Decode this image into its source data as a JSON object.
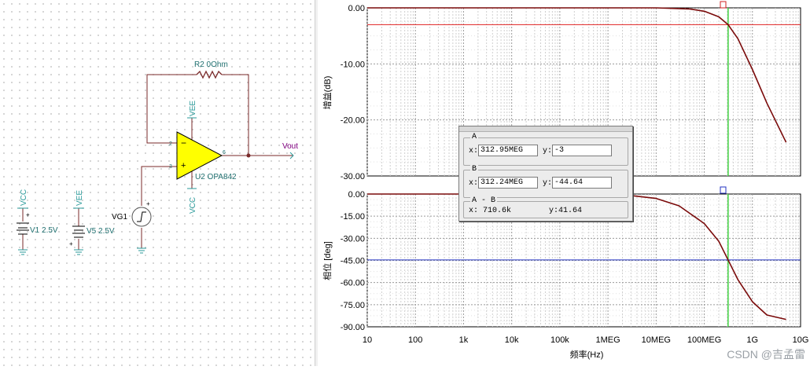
{
  "schematic": {
    "r2_label": "R2 0Ohm",
    "vee_top": "VEE",
    "vcc_bottom": "VCC",
    "pin2": "2",
    "pin3": "3",
    "pin6": "6",
    "u2_label": "U2 OPA842",
    "vout_label": "Vout",
    "vg1_label": "VG1",
    "v1_net": "VCC",
    "v1_label": "V1 2.5V",
    "v5_net": "VEE",
    "v5_label": "V5 2.5V"
  },
  "colors": {
    "curve": "#7a0a0a",
    "red_cursor_line": "#e02020",
    "blue_cursor_line": "#2030c0",
    "green_cursor_line": "#40d040",
    "opamp_fill": "#ffff00",
    "wire": "#7a2a2a",
    "net_label": "#2a9a9a"
  },
  "chart_data": [
    {
      "type": "line",
      "ylabel": "增益(dB)",
      "xscale": "log",
      "xlim": [
        10,
        10000000000
      ],
      "ylim": [
        -30,
        0
      ],
      "yticks": [
        "0.00",
        "-10.00",
        "-20.00",
        "-30.00"
      ],
      "grid": true,
      "series": [
        {
          "x": [
            10,
            100,
            1000,
            10000,
            100000,
            1000000,
            10000000,
            50000000,
            100000000,
            200000000,
            312950000,
            500000000,
            1000000000,
            2000000000,
            5000000000
          ],
          "y": [
            0,
            0,
            0,
            0,
            0,
            0,
            0,
            -0.2,
            -0.6,
            -1.6,
            -3,
            -5.5,
            -11,
            -17,
            -24
          ]
        }
      ],
      "cursor_y": -3,
      "cursor_x": 312950000
    },
    {
      "type": "line",
      "ylabel": "相位 [deg]",
      "xlabel": "频率(Hz)",
      "xscale": "log",
      "xlim": [
        10,
        10000000000
      ],
      "ylim": [
        -90,
        0
      ],
      "yticks": [
        "0.00",
        "-15.00",
        "-30.00",
        "-45.00",
        "-60.00",
        "-75.00",
        "-90.00"
      ],
      "xticks": [
        "10",
        "100",
        "1k",
        "10k",
        "100k",
        "1MEG",
        "10MEG",
        "100MEG",
        "1G",
        "10G"
      ],
      "grid": true,
      "series": [
        {
          "x": [
            10,
            100,
            1000,
            10000,
            100000,
            1000000,
            3000000,
            10000000,
            30000000,
            100000000,
            200000000,
            312240000,
            500000000,
            1000000000,
            2000000000,
            5000000000
          ],
          "y": [
            0,
            0,
            0,
            0,
            0,
            -0.3,
            -1,
            -3,
            -8,
            -20,
            -32,
            -44.64,
            -58,
            -73,
            -82,
            -85
          ]
        }
      ],
      "cursor_y": -44.64,
      "cursor_x": 312240000
    }
  ],
  "cursor_box": {
    "a_title": "A",
    "a_x_label": "x:",
    "a_x_value": "312.95MEG",
    "a_y_label": "y:",
    "a_y_value": "-3",
    "b_title": "B",
    "b_x_label": "x:",
    "b_x_value": "312.24MEG",
    "b_y_label": "y:",
    "b_y_value": "-44.64",
    "ab_title": "A - B",
    "ab_x": "x: 710.6k",
    "ab_y": "y:41.64"
  },
  "watermark": "CSDN @吉孟雷"
}
